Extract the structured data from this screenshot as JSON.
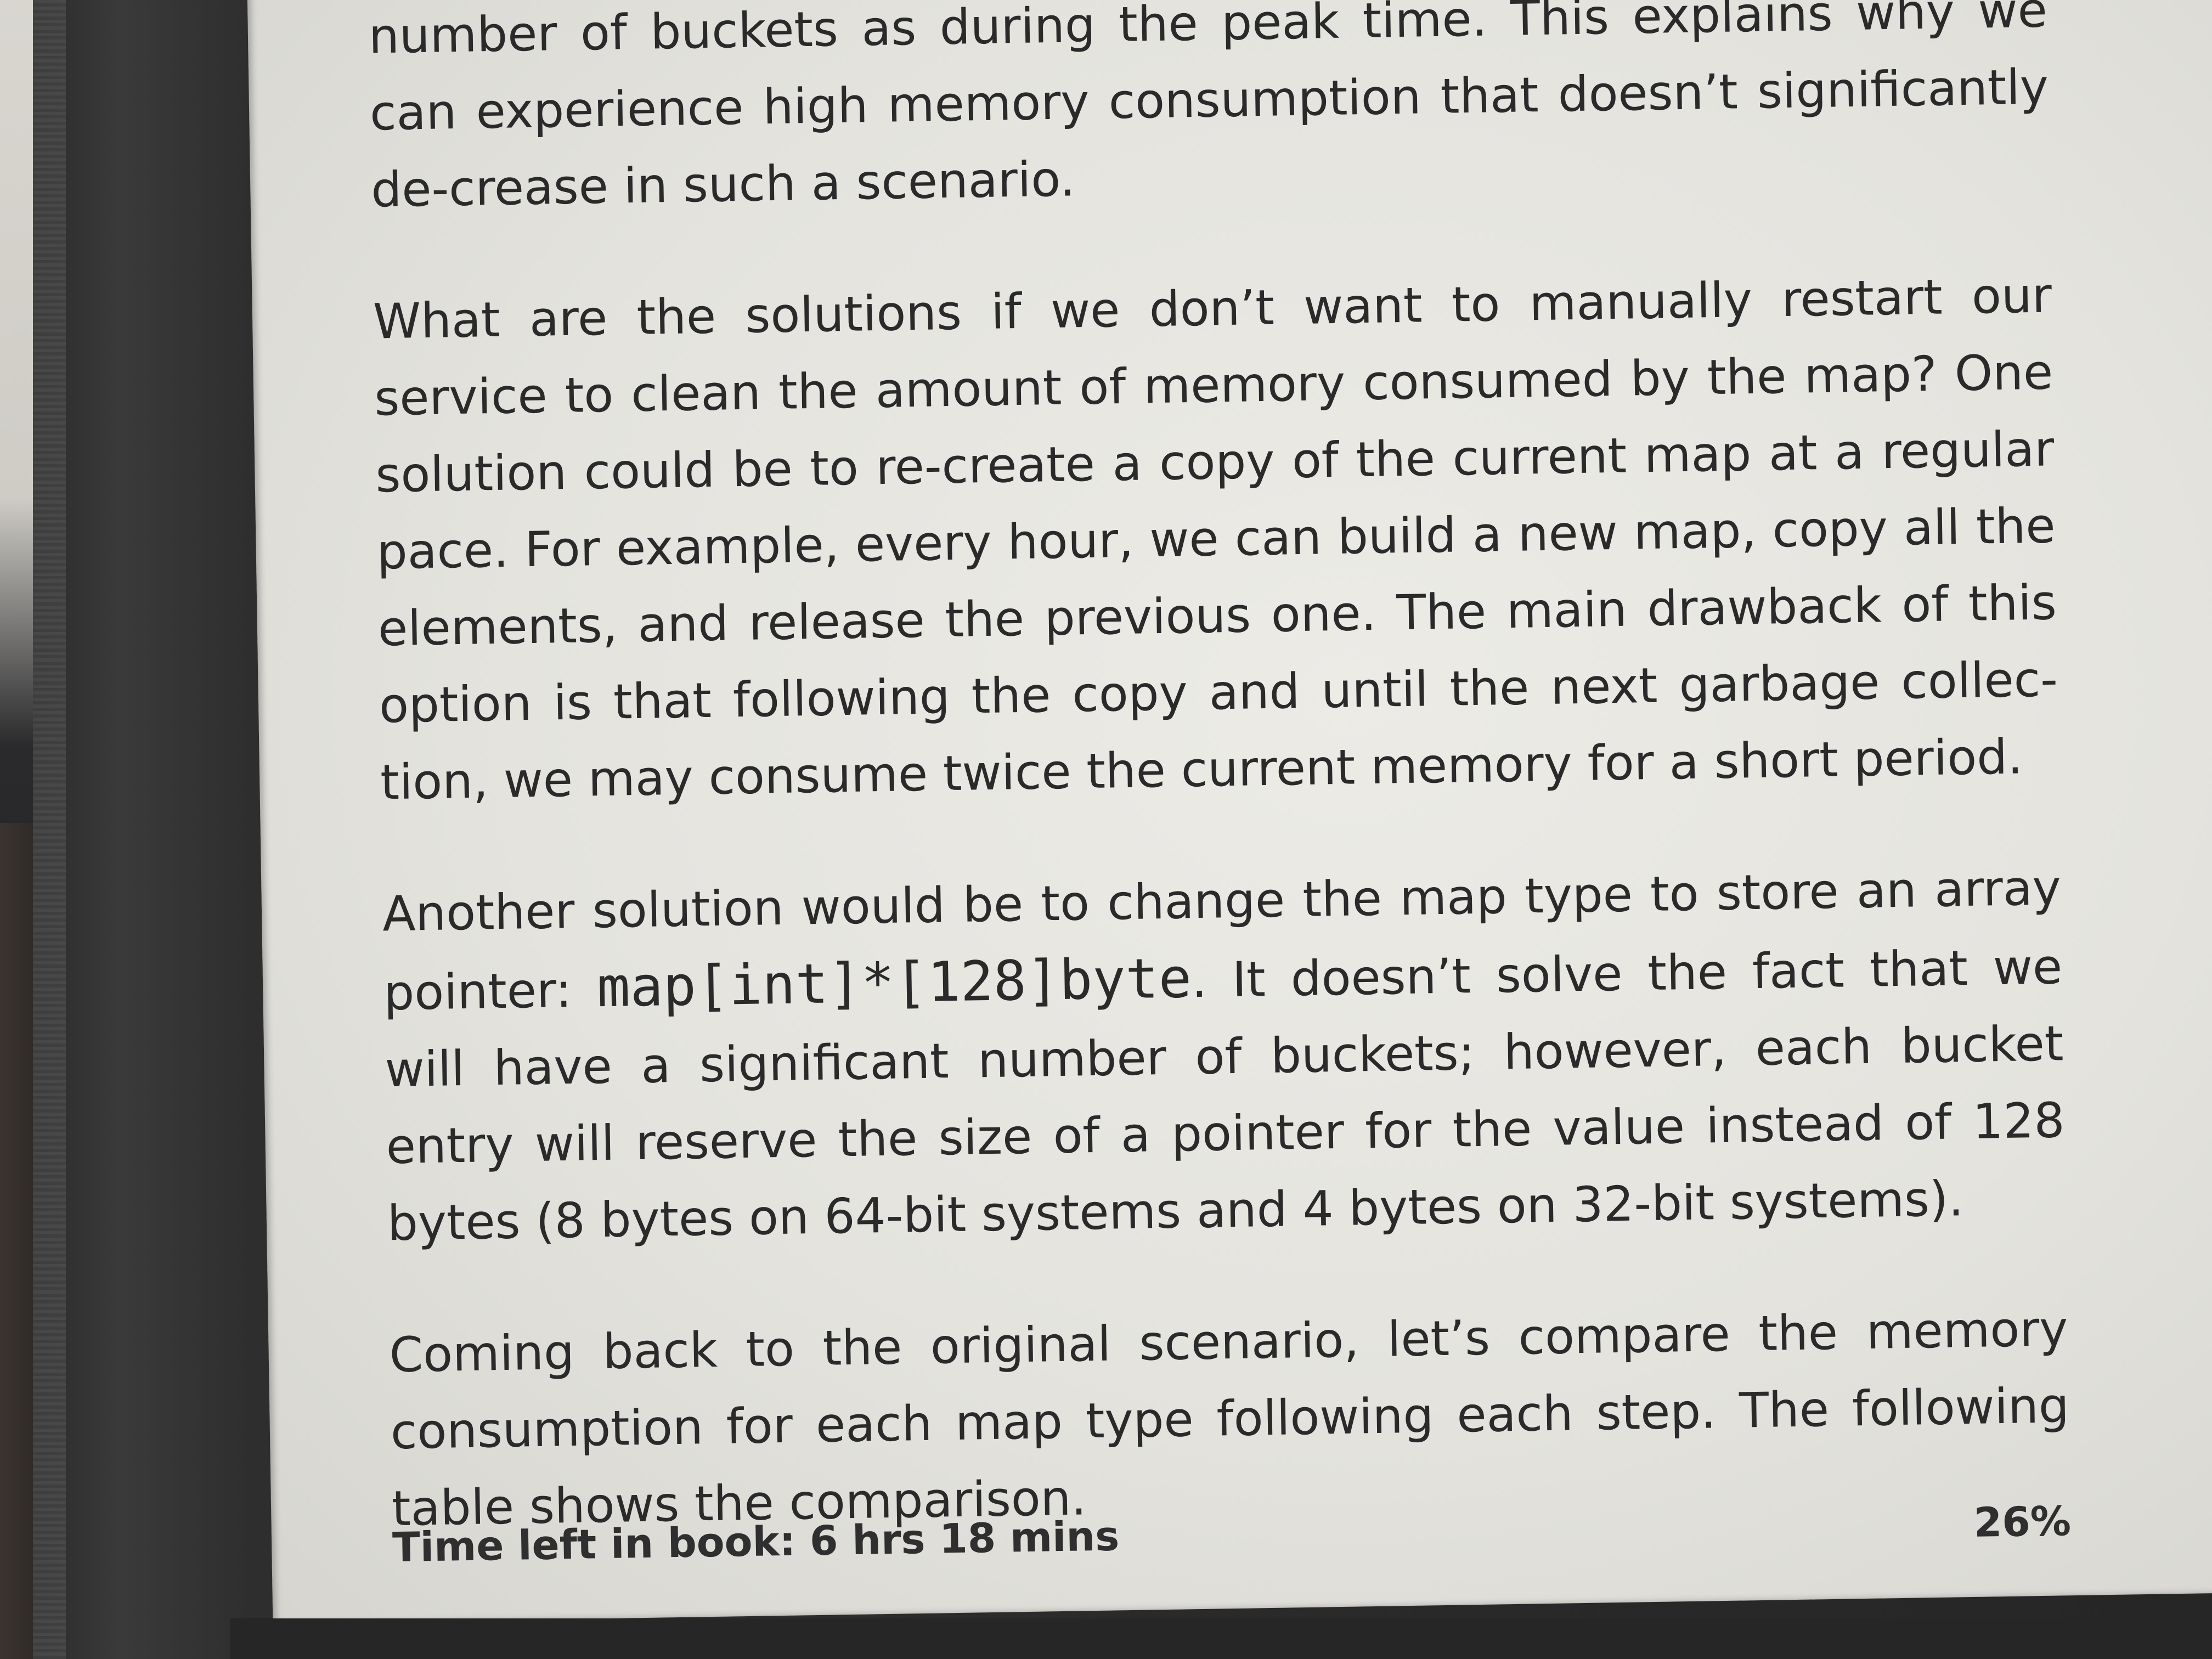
{
  "book": {
    "paragraphs": [
      {
        "id": "p1",
        "text": "number of buckets as during the peak time. This explains why we can experience high memory consumption that doesn’t significantly de-crease in such a scenario."
      },
      {
        "id": "p2",
        "text": "What are the solutions if we don’t want to manually restart our service to clean the amount of memory consumed by the map? One solution could be to re-create a copy of the current map at a regular pace. For example, every hour, we can build a new map, copy all the elements, and release the previous one. The main drawback of this option is that following the copy and until the next garbage collec-tion, we may consume twice the current memory for a short period."
      },
      {
        "id": "p3",
        "before_code": "Another solution would be to change the map type to store an array pointer: ",
        "code": "map[int]*[128]byte",
        "after_code": ". It doesn’t solve the fact that we will have a significant number of buckets; however, each bucket entry will reserve the size of a pointer for the value instead of 128 bytes (8 bytes on 64-bit systems and 4 bytes on 32-bit systems)."
      },
      {
        "id": "p4",
        "text": "Coming back to the original scenario, let’s compare the memory consumption for each map type following each step. The following table shows the comparison."
      }
    ]
  },
  "footer": {
    "time_left": "Time left in book: 6 hrs 18 mins",
    "progress_label": "26%",
    "progress": 0.26
  }
}
